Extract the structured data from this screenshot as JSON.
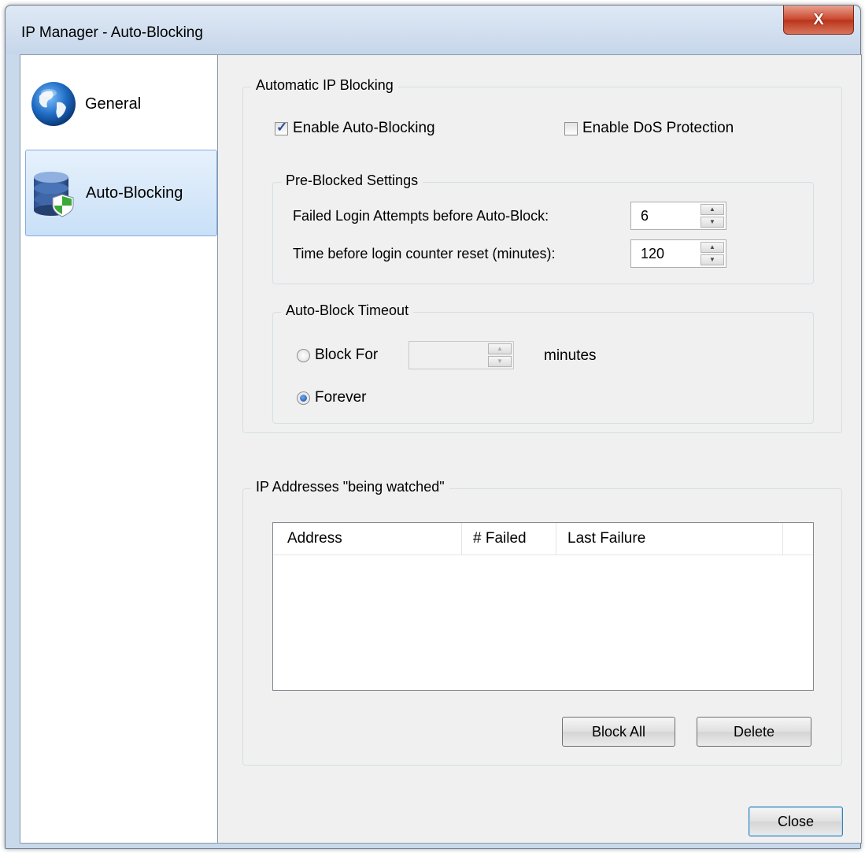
{
  "window": {
    "title": "IP Manager - Auto-Blocking",
    "close_glyph": "X"
  },
  "sidebar": {
    "items": [
      {
        "label": "General",
        "icon": "globe-icon",
        "selected": false
      },
      {
        "label": "Auto-Blocking",
        "icon": "database-shield-icon",
        "selected": true
      }
    ]
  },
  "auto_blocking": {
    "group_title": "Automatic IP Blocking",
    "enable_auto_blocking": {
      "label": "Enable Auto-Blocking",
      "checked": true
    },
    "enable_dos": {
      "label": "Enable DoS Protection",
      "checked": false
    },
    "pre_blocked": {
      "title": "Pre-Blocked Settings",
      "failed_attempts_label": "Failed Login Attempts before Auto-Block:",
      "failed_attempts_value": "6",
      "reset_time_label": "Time before login counter reset (minutes):",
      "reset_time_value": "120"
    },
    "timeout": {
      "title": "Auto-Block Timeout",
      "block_for_label": "Block For",
      "block_for_value": "",
      "minutes_label": "minutes",
      "forever_label": "Forever",
      "selected": "forever"
    }
  },
  "watched": {
    "group_title": "IP Addresses \"being watched\"",
    "columns": [
      "Address",
      "# Failed",
      "Last Failure"
    ],
    "rows": [],
    "block_all_label": "Block All",
    "delete_label": "Delete"
  },
  "footer": {
    "close_label": "Close"
  },
  "colors": {
    "selection_bg": "#c9e0f7",
    "window_frame": "#c9d9ec",
    "close_button": "#c9462c"
  }
}
